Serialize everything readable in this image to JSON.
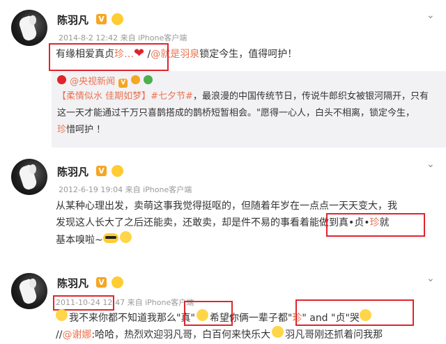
{
  "posts": [
    {
      "author": "陈羽凡",
      "verified_badge": "V",
      "meta": "2014-8-2 12:42 来自 iPhone客户端",
      "text_highlight": "有缘相爱真贞",
      "text_highlight_tail": "珍…",
      "text_rest_a": "/",
      "text_mention": "@就是羽泉",
      "text_rest_b": "锁定今生，值得呵护！",
      "quote": {
        "source": "@央视新闻",
        "line1_link": "【柔情似水 佳期如梦】",
        "line1_tag": "#七夕节#",
        "line1_rest": "，最浪漫的中国传统节日，传说牛郎织女被银河隔开，只有",
        "line2": "这一天才能通过千万只喜鹊搭成的鹊桥短暂相会。\"愿得一心人，白头不相离，锁定今生，",
        "line3_link": "珍",
        "line3_rest": "惜呵护 ！"
      }
    },
    {
      "author": "陈羽凡",
      "verified_badge": "V",
      "meta": "2012-6-19 19:04 来自 iPhone客户端",
      "line1": "从某种心理出发，卖萌这事我觉得挺呕的，但随着年岁在一点点一天天变大，我",
      "line2_a": "发现这人长大了之后还能卖，还敢卖，却是件不易的事",
      "line2_highlight_a": "看着能做到真•贞•",
      "line2_highlight_link": "珍",
      "line2_tail": "就",
      "line3": "基本嗅啦~"
    },
    {
      "author": "陈羽凡",
      "verified_badge": "V",
      "meta_date": "2011-10-24 1",
      "meta_rest": "2:47 来自 iPhone客户端",
      "line1_a": "我不来你都不知道我那么",
      "line1_box1": "\"真\"",
      "line1_b": "希望你俩一辈子都",
      "line1_box2_a": "\"",
      "line1_box2_link": "珍",
      "line1_box2_b": "\" and \"贞\"",
      "line1_tail": "哭",
      "line2_a": "//",
      "line2_mention": "@谢娜",
      "line2_b": ":哈哈，热烈欢迎羽凡哥，白百何来快乐大",
      "line2_c": "羽凡哥刚还抓着问我那"
    }
  ],
  "icons": {
    "more": "chevron-down-icon",
    "emoji": "laughing-emoji-icon",
    "heart": "❤"
  },
  "colors": {
    "highlight_box": "#e0242c",
    "link": "#eb7350",
    "quote_bg": "#f2f2f5"
  }
}
